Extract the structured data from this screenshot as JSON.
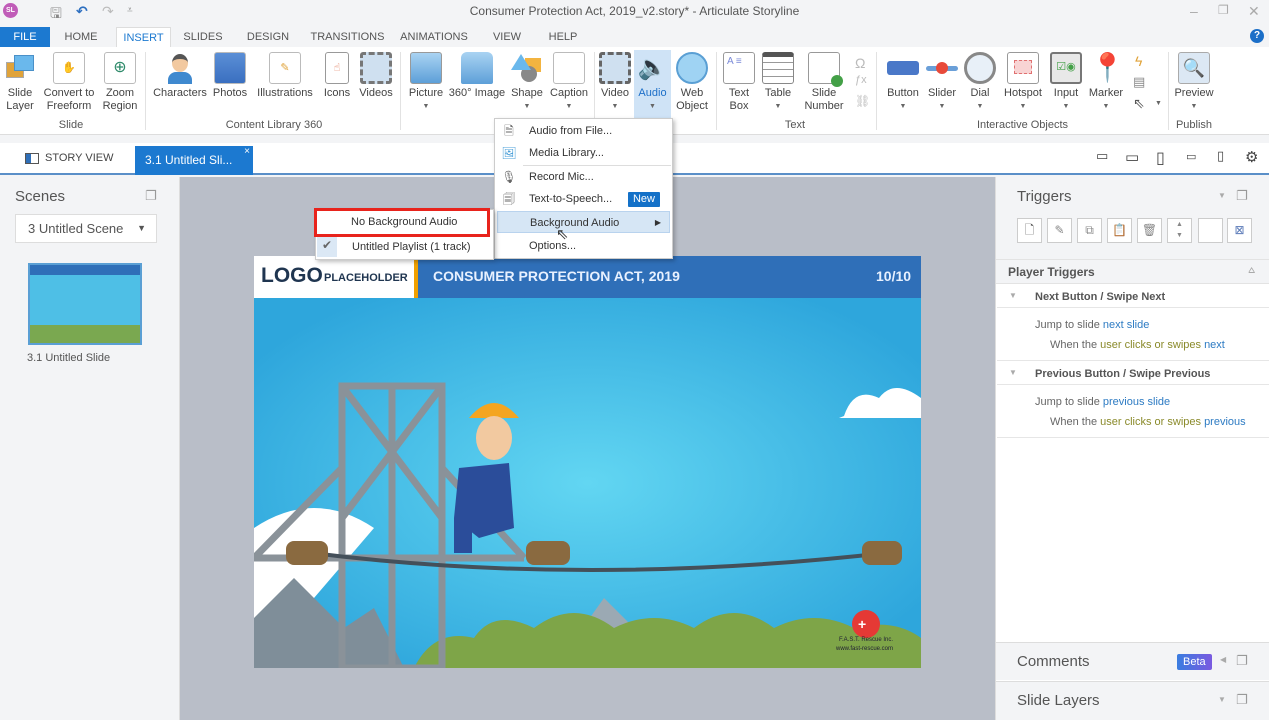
{
  "window": {
    "app_logo": "SL",
    "title": "Consumer Protection Act, 2019_v2.story* -  Articulate Storyline",
    "help": "?"
  },
  "ribbon_tabs": [
    "FILE",
    "HOME",
    "INSERT",
    "SLIDES",
    "DESIGN",
    "TRANSITIONS",
    "ANIMATIONS",
    "VIEW",
    "HELP"
  ],
  "active_tab": "INSERT",
  "ribbon": {
    "groups": {
      "slide": "Slide",
      "content_library": "Content Library 360",
      "text": "Text",
      "interactive": "Interactive Objects",
      "publish": "Publish"
    },
    "buttons": {
      "slide_layer": [
        "Slide",
        "Layer"
      ],
      "convert_freeform": [
        "Convert to",
        "Freeform"
      ],
      "zoom_region": [
        "Zoom",
        "Region"
      ],
      "characters": "Characters",
      "photos": "Photos",
      "illustrations": "Illustrations",
      "icons": "Icons",
      "videos": "Videos",
      "picture": "Picture",
      "image360": "360° Image",
      "shape": "Shape",
      "caption": "Caption",
      "video": "Video",
      "audio": "Audio",
      "web_object": [
        "Web",
        "Object"
      ],
      "text_box": [
        "Text",
        "Box"
      ],
      "table": "Table",
      "slide_number": [
        "Slide",
        "Number"
      ],
      "button": "Button",
      "slider": "Slider",
      "dial": "Dial",
      "hotspot": "Hotspot",
      "input": "Input",
      "marker": "Marker",
      "preview": "Preview"
    },
    "small_icons": [
      "omega-symbol-icon",
      "equation-icon",
      "link-icon",
      "trigger-icon",
      "layer-panel-icon",
      "cursor-icon"
    ]
  },
  "doc_tabs": {
    "story_view": "STORY VIEW",
    "slide_tab": "3.1 Untitled Sli...",
    "close": "×"
  },
  "scenes_panel": {
    "title": "Scenes",
    "scene_dropdown": "3 Untitled Scene",
    "slide_label": "3.1 Untitled Slide"
  },
  "audio_menu": {
    "items": [
      {
        "label": "Audio from File...",
        "icon": "audio-file-icon"
      },
      {
        "label": "Media Library...",
        "icon": "media-library-icon"
      },
      {
        "label": "Record Mic...",
        "icon": "microphone-icon"
      },
      {
        "label": "Text-to-Speech...",
        "icon": "text-to-speech-icon",
        "badge": "New"
      },
      {
        "label": "Background Audio",
        "highlighted": true,
        "submenu": true
      },
      {
        "label": "Options..."
      }
    ]
  },
  "background_audio_submenu": {
    "items": [
      {
        "label": "No Background Audio",
        "outlined": true
      },
      {
        "label": "Untitled Playlist (1 track)",
        "checked": true
      }
    ]
  },
  "slide": {
    "logo": "LOGO",
    "logo_sub": "PLACEHOLDER",
    "title": "CONSUMER PROTECTION ACT, 2019",
    "counter": "10/10",
    "brand_line1": "F.A.S.T. Rescue Inc.",
    "brand_line2": "www.fast-rescue.com"
  },
  "triggers_panel": {
    "title": "Triggers",
    "section": "Player Triggers",
    "triggers": [
      {
        "name": "Next Button / Swipe Next",
        "action_prefix": "Jump to slide ",
        "action_target": "next slide",
        "cond_prefix": "When the ",
        "cond_user": "user clicks or swipes",
        "cond_target": "next"
      },
      {
        "name": "Previous Button / Swipe Previous",
        "action_prefix": "Jump to slide ",
        "action_target": "previous slide",
        "cond_prefix": "When the ",
        "cond_user": "user clicks or swipes",
        "cond_target": "previous"
      }
    ]
  },
  "comments_panel": {
    "title": "Comments",
    "badge": "Beta"
  },
  "slide_layers_panel": {
    "title": "Slide Layers"
  },
  "colors": {
    "accent": "#1c79d0",
    "header_blue": "#2f6fb8",
    "logo_bar": "#f0a000",
    "highlight_outline": "#e8231c"
  }
}
